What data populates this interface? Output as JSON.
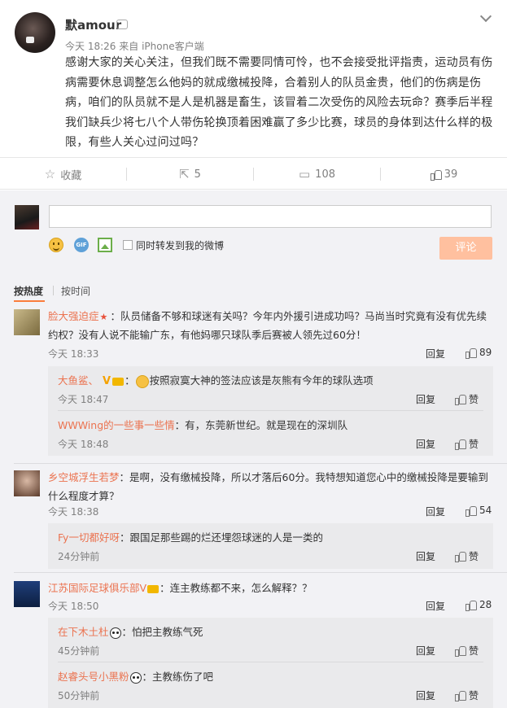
{
  "post": {
    "username": "默amour",
    "time": "今天 18:26",
    "source_prefix": "来自",
    "source": "iPhone客户端",
    "content": "感谢大家的关心关注，但我们既不需要同情可怜，也不会接受批评指责，运动员有伤病需要休息调整怎么他妈的就成缴械投降，合着别人的队员金贵，他们的伤病是伤病，咱们的队员就不是人是机器是畜生，该冒着二次受伤的风险去玩命？赛季后半程我们缺兵少将七八个人带伤轮换顶着困难赢了多少比赛，球员的身体到达什么样的极限，有些人关心过问过吗？"
  },
  "actions": {
    "favorite": "收藏",
    "repost": "5",
    "comment": "108",
    "like": "39"
  },
  "composer": {
    "input_value": "",
    "checkbox_label": "同时转发到我的微博",
    "submit_label": "评论",
    "gif_label": "GIF"
  },
  "sort": {
    "hot": "按热度",
    "time": "按时间"
  },
  "comments": [
    {
      "name": "脸大强迫症",
      "text": "：队员储备不够和球迷有关吗？今年内外援引进成功吗？马尚当时究竟有没有优先续约权？没有人说不能输广东，有他妈哪只球队季后赛被人领先过60分！",
      "time": "今天 18:33",
      "reply": "回复",
      "likes": "89",
      "subs": [
        {
          "name": "大鱼鲨、",
          "text": "按照寂寞大神的签法应该是灰熊有今年的球队选项",
          "time": "今天 18:47",
          "reply": "回复",
          "likes": "赞"
        },
        {
          "name": "WWWing的一些事一些情",
          "text": "：有，东莞新世纪。就是现在的深圳队",
          "time": "今天 18:48",
          "reply": "回复",
          "likes": "赞"
        }
      ]
    },
    {
      "name": "乡空城浮生若梦",
      "text": "：是啊，没有缴械投降，所以才落后60分。我特想知道您心中的缴械投降是要输到什么程度才算？",
      "time": "今天 18:38",
      "reply": "回复",
      "likes": "54",
      "subs": [
        {
          "name": "Fy一切都好呀",
          "text": "：跟国足那些踢的烂还埋怨球迷的人是一类的",
          "time": "24分钟前",
          "reply": "回复",
          "likes": "赞"
        }
      ]
    },
    {
      "name": "江苏国际足球俱乐部V",
      "text": "：连主教练都不来，怎么解释？？",
      "time": "今天 18:50",
      "reply": "回复",
      "likes": "28",
      "subs": [
        {
          "name": "在下木土杜",
          "text": "：怕把主教练气死",
          "time": "45分钟前",
          "reply": "回复",
          "likes": "赞"
        },
        {
          "name": "赵睿头号小黑粉",
          "text": "：主教练伤了吧",
          "time": "50分钟前",
          "reply": "回复",
          "likes": "赞"
        }
      ]
    }
  ]
}
